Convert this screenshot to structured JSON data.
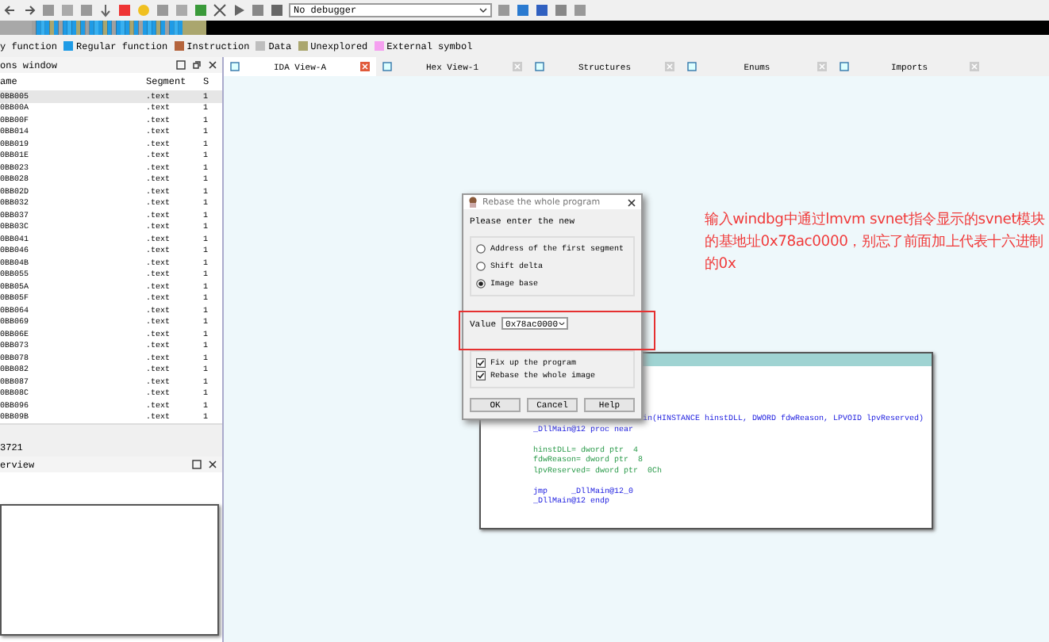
{
  "toolbar": {
    "debugger_select": "No debugger"
  },
  "legend": [
    {
      "label": "y function"
    },
    {
      "label": "Regular function",
      "color": "#1e9be6"
    },
    {
      "label": "Instruction",
      "color": "#b4643c"
    },
    {
      "label": "Data",
      "color": "#bebebe"
    },
    {
      "label": "Unexplored",
      "color": "#aaa66e"
    },
    {
      "label": "External symbol",
      "color": "#f5a0f0"
    }
  ],
  "functions_window": {
    "title": "ons window",
    "columns": [
      "ame",
      "Segment",
      "S"
    ],
    "rows": [
      {
        "name": "0BB005",
        "segment": ".text",
        "s": "1",
        "selected": true
      },
      {
        "name": "0BB00A",
        "segment": ".text",
        "s": "1",
        "selected": false
      },
      {
        "name": "0BB00F",
        "segment": ".text",
        "s": "1",
        "selected": false
      },
      {
        "name": "0BB014",
        "segment": ".text",
        "s": "1",
        "selected": false
      },
      {
        "name": "0BB019",
        "segment": ".text",
        "s": "1",
        "selected": false
      },
      {
        "name": "0BB01E",
        "segment": ".text",
        "s": "1",
        "selected": false
      },
      {
        "name": "0BB023",
        "segment": ".text",
        "s": "1",
        "selected": false
      },
      {
        "name": "0BB028",
        "segment": ".text",
        "s": "1",
        "selected": false
      },
      {
        "name": "0BB02D",
        "segment": ".text",
        "s": "1",
        "selected": false
      },
      {
        "name": "0BB032",
        "segment": ".text",
        "s": "1",
        "selected": false
      },
      {
        "name": "0BB037",
        "segment": ".text",
        "s": "1",
        "selected": false
      },
      {
        "name": "0BB03C",
        "segment": ".text",
        "s": "1",
        "selected": false
      },
      {
        "name": "0BB041",
        "segment": ".text",
        "s": "1",
        "selected": false
      },
      {
        "name": "0BB046",
        "segment": ".text",
        "s": "1",
        "selected": false
      },
      {
        "name": "0BB04B",
        "segment": ".text",
        "s": "1",
        "selected": false
      },
      {
        "name": "0BB055",
        "segment": ".text",
        "s": "1",
        "selected": false
      },
      {
        "name": "0BB05A",
        "segment": ".text",
        "s": "1",
        "selected": false
      },
      {
        "name": "0BB05F",
        "segment": ".text",
        "s": "1",
        "selected": false
      },
      {
        "name": "0BB064",
        "segment": ".text",
        "s": "1",
        "selected": false
      },
      {
        "name": "0BB069",
        "segment": ".text",
        "s": "1",
        "selected": false
      },
      {
        "name": "0BB06E",
        "segment": ".text",
        "s": "1",
        "selected": false
      },
      {
        "name": "0BB073",
        "segment": ".text",
        "s": "1",
        "selected": false
      },
      {
        "name": "0BB078",
        "segment": ".text",
        "s": "1",
        "selected": false
      },
      {
        "name": "0BB082",
        "segment": ".text",
        "s": "1",
        "selected": false
      },
      {
        "name": "0BB087",
        "segment": ".text",
        "s": "1",
        "selected": false
      },
      {
        "name": "0BB08C",
        "segment": ".text",
        "s": "1",
        "selected": false
      },
      {
        "name": "0BB096",
        "segment": ".text",
        "s": "1",
        "selected": false
      },
      {
        "name": "0BB09B",
        "segment": ".text",
        "s": "1",
        "selected": false
      }
    ],
    "status": "3721"
  },
  "overview": {
    "title": "erview"
  },
  "tabs": [
    {
      "label": "IDA View-A",
      "selected": true
    },
    {
      "label": "Hex View-1",
      "selected": false
    },
    {
      "label": "Structures",
      "selected": false
    },
    {
      "label": "Enums",
      "selected": false
    },
    {
      "label": "Imports",
      "selected": false
    }
  ],
  "code": [
    {
      "text": "in(HINSTANCE hinstDLL, DWORD fdwReason, LPVOID lpvReserved)",
      "kind": "tail"
    },
    {
      "text": "_DllMain@12 proc near",
      "kind": "proto"
    },
    {
      "text": "hinstDLL= dword ptr  4",
      "kind": "var",
      "spaced": true
    },
    {
      "text": "fdwReason= dword ptr  8",
      "kind": "var"
    },
    {
      "text": "lpvReserved= dword ptr  0Ch",
      "kind": "var"
    },
    {
      "text": "jmp     _DllMain@12_0",
      "kind": "proto",
      "spaced": true
    },
    {
      "text": "_DllMain@12 endp",
      "kind": "proto"
    }
  ],
  "dialog": {
    "title": "Rebase the whole program",
    "prompt": "Please enter the new",
    "options": [
      {
        "label": "Address of the first segment",
        "selected": false
      },
      {
        "label": "Shift delta",
        "selected": false
      },
      {
        "label": "Image base",
        "selected": true
      }
    ],
    "value_label": "Value",
    "value": "0x78ac0000",
    "checkboxes": [
      {
        "label": "Fix up the program",
        "checked": true
      },
      {
        "label": "Rebase the whole image",
        "checked": true
      }
    ],
    "buttons": [
      "OK",
      "Cancel",
      "Help"
    ]
  },
  "annotation": "输入windbg中通过lmvm svnet指令显示的svnet模块的基地址0x78ac0000，别忘了前面加上代表十六进制的0x"
}
